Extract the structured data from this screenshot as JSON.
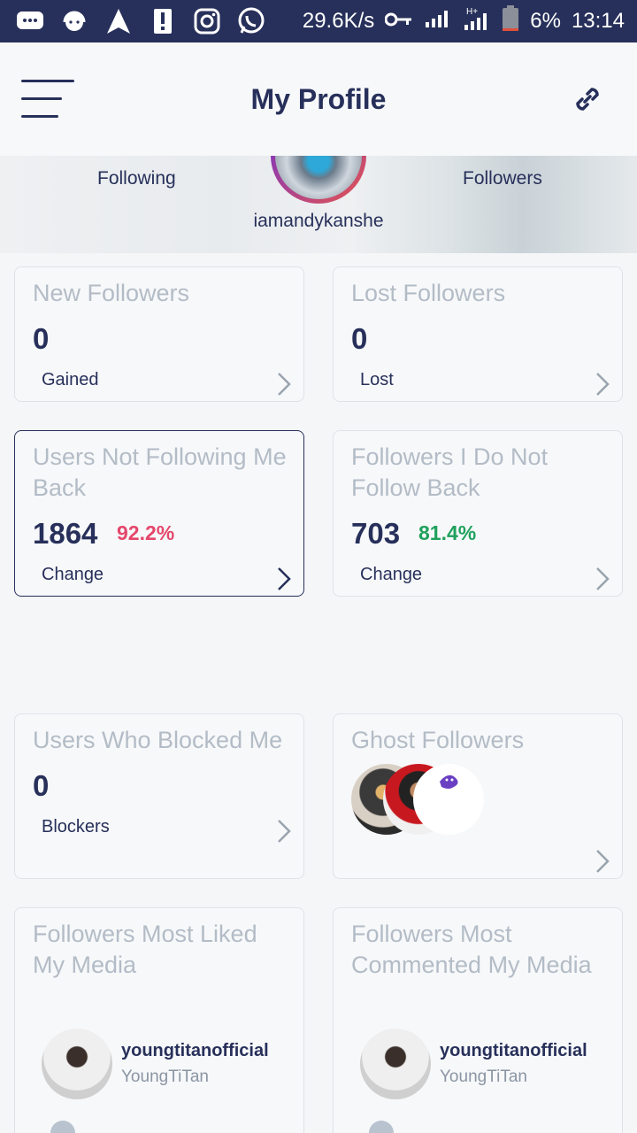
{
  "status_bar": {
    "speed": "29.6K/s",
    "battery": "6%",
    "time": "13:14",
    "icons_left": [
      "chat-icon",
      "headset-icon",
      "arrow-nav-icon",
      "alert-icon",
      "instagram-icon",
      "whatsapp-icon"
    ],
    "icons_right": [
      "key-icon",
      "signal-icon",
      "signal-hplus-icon",
      "battery-icon"
    ]
  },
  "header": {
    "title": "My Profile",
    "menu_icon": "hamburger-icon",
    "link_icon": "link-icon"
  },
  "profile": {
    "following_label": "Following",
    "followers_label": "Followers",
    "username": "iamandykanshe"
  },
  "cards": {
    "new_followers": {
      "title": "New Followers",
      "count": "0",
      "sub": "Gained"
    },
    "lost_followers": {
      "title": "Lost Followers",
      "count": "0",
      "sub": "Lost"
    },
    "not_following_back": {
      "title": "Users Not Following Me Back",
      "count": "1864",
      "percent": "92.2%",
      "sub": "Change"
    },
    "i_do_not_follow_back": {
      "title": "Followers I Do Not Follow Back",
      "count": "703",
      "percent": "81.4%",
      "sub": "Change"
    },
    "blocked_me": {
      "title": "Users Who Blocked Me",
      "count": "0",
      "sub": "Blockers"
    },
    "ghost_followers": {
      "title": "Ghost Followers"
    },
    "most_liked": {
      "title": "Followers Most Liked My Media",
      "handle": "youngtitanofficial",
      "name": "YoungTiTan"
    },
    "most_commented": {
      "title": "Followers Most Commented My Media",
      "handle": "youngtitanofficial",
      "name": "YoungTiTan"
    }
  },
  "colors": {
    "primary": "#27305a",
    "muted_title": "#b3bcc6",
    "percent_red": "#e5476c",
    "percent_green": "#1fa15c"
  }
}
